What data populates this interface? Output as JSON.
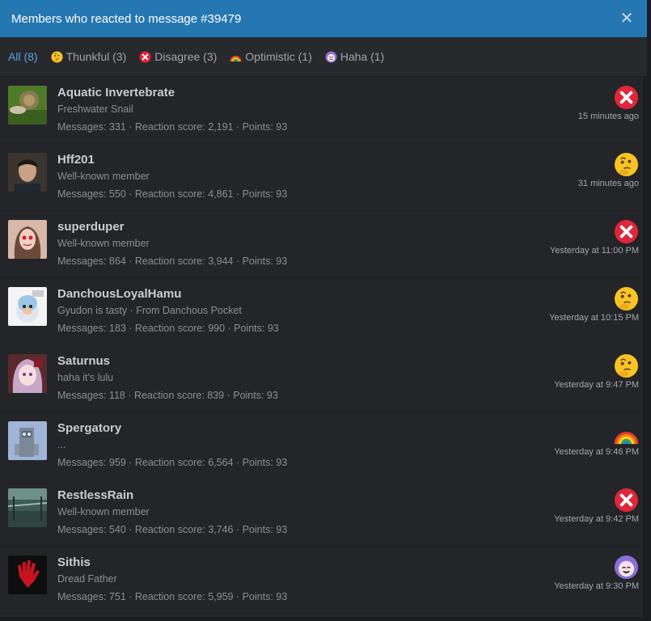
{
  "header": {
    "title": "Members who reacted to message #39479"
  },
  "tabs": [
    {
      "label": "All (8)",
      "icon": ""
    },
    {
      "label": "Thunkful (3)",
      "icon": "thinking-icon"
    },
    {
      "label": "Disagree (3)",
      "icon": "disagree-icon"
    },
    {
      "label": "Optimistic (1)",
      "icon": "rainbow-icon"
    },
    {
      "label": "Haha (1)",
      "icon": "haha-icon"
    }
  ],
  "members": [
    {
      "name": "Aquatic Invertebrate",
      "title": "Freshwater Snail",
      "stats": "Messages: 331 · Reaction score: 2,191 · Points: 93",
      "reaction": "disagree",
      "time": "15 minutes ago"
    },
    {
      "name": "Hff201",
      "title": "Well-known member",
      "stats": "Messages: 550 · Reaction score: 4,861 · Points: 93",
      "reaction": "thinking",
      "time": "31 minutes ago"
    },
    {
      "name": "superduper",
      "title": "Well-known member",
      "stats": "Messages: 864 · Reaction score: 3,944 · Points: 93",
      "reaction": "disagree",
      "time": "Yesterday at 11:00 PM"
    },
    {
      "name": "DanchousLoyalHamu",
      "title": "Gyudon is tasty · From Danchous Pocket",
      "stats": "Messages: 183 · Reaction score: 990 · Points: 93",
      "reaction": "thinking",
      "time": "Yesterday at 10:15 PM"
    },
    {
      "name": "Saturnus",
      "title": "haha it's lulu",
      "stats": "Messages: 118 · Reaction score: 839 · Points: 93",
      "reaction": "thinking",
      "time": "Yesterday at 9:47 PM"
    },
    {
      "name": "Spergatory",
      "title": "...",
      "stats": "Messages: 959 · Reaction score: 6,564 · Points: 93",
      "reaction": "rainbow",
      "time": "Yesterday at 9:46 PM"
    },
    {
      "name": "RestlessRain",
      "title": "Well-known member",
      "stats": "Messages: 540 · Reaction score: 3,746 · Points: 93",
      "reaction": "disagree",
      "time": "Yesterday at 9:42 PM"
    },
    {
      "name": "Sithis",
      "title": "Dread Father",
      "stats": "Messages: 751 · Reaction score: 5,959 · Points: 93",
      "reaction": "haha",
      "time": "Yesterday at 9:30 PM"
    }
  ],
  "colors": {
    "header_bg": "#2577b1",
    "active_tab": "#56a6e0",
    "disagree": "#e0263a",
    "thinking": "#f7c325"
  }
}
